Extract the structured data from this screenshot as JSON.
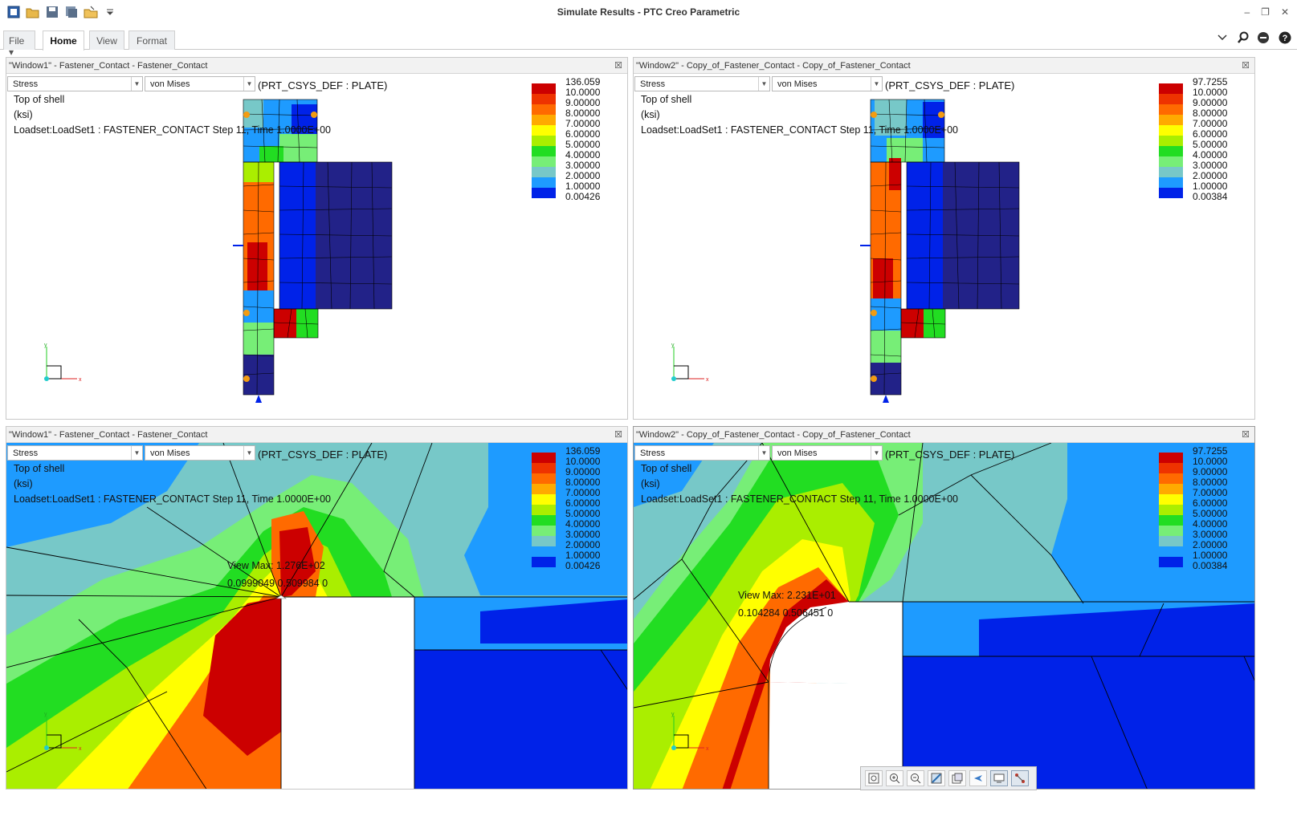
{
  "window": {
    "title": "Simulate Results - PTC Creo Parametric",
    "controls": [
      "minimize-icon",
      "restore-icon",
      "close-icon"
    ]
  },
  "quick_access": [
    "app-icon",
    "open-icon",
    "save-icon",
    "save-copy-icon",
    "open-folder-icon",
    "customize-dropdown-icon"
  ],
  "ribbon": {
    "tabs": [
      {
        "label": "File"
      },
      {
        "label": "Home",
        "active": true
      },
      {
        "label": "View"
      },
      {
        "label": "Format"
      }
    ],
    "right_icons": [
      "collapse-ribbon-icon",
      "search-icon",
      "community-icon",
      "help-icon"
    ]
  },
  "panes": [
    {
      "title": "\"Window1\" - Fastener_Contact - Fastener_Contact",
      "quantity": "Stress",
      "component": "von Mises",
      "csys": "(PRT_CSYS_DEF : PLATE)",
      "info": [
        "Top of shell",
        "(ksi)",
        "Loadset:LoadSet1 :  FASTENER_CONTACT Step 11, Time  1.0000E+00"
      ],
      "legend": [
        "136.059",
        "10.0000",
        "9.00000",
        "8.00000",
        "7.00000",
        "6.00000",
        "5.00000",
        "4.00000",
        "3.00000",
        "2.00000",
        "1.00000",
        "0.00426"
      ]
    },
    {
      "title": "\"Window2\" - Copy_of_Fastener_Contact - Copy_of_Fastener_Contact",
      "quantity": "Stress",
      "component": "von Mises",
      "csys": "(PRT_CSYS_DEF : PLATE)",
      "info": [
        "Top of shell",
        "(ksi)",
        "Loadset:LoadSet1 :  FASTENER_CONTACT Step 11, Time  1.0000E+00"
      ],
      "legend": [
        "97.7255",
        "10.0000",
        "9.00000",
        "8.00000",
        "7.00000",
        "6.00000",
        "5.00000",
        "4.00000",
        "3.00000",
        "2.00000",
        "1.00000",
        "0.00384"
      ]
    },
    {
      "title": "\"Window1\" - Fastener_Contact - Fastener_Contact",
      "quantity": "Stress",
      "component": "von Mises",
      "csys": "(PRT_CSYS_DEF : PLATE)",
      "info": [
        "Top of shell",
        "(ksi)",
        "Loadset:LoadSet1 :  FASTENER_CONTACT Step 11, Time  1.0000E+00"
      ],
      "legend": [
        "136.059",
        "10.0000",
        "9.00000",
        "8.00000",
        "7.00000",
        "6.00000",
        "5.00000",
        "4.00000",
        "3.00000",
        "2.00000",
        "1.00000",
        "0.00426"
      ],
      "view_max": [
        "View Max:  1.276E+02",
        "0.0999049  0.509984  0"
      ]
    },
    {
      "title": "\"Window2\" - Copy_of_Fastener_Contact - Copy_of_Fastener_Contact",
      "quantity": "Stress",
      "component": "von Mises",
      "csys": "(PRT_CSYS_DEF : PLATE)",
      "info": [
        "Top of shell",
        "(ksi)",
        "Loadset:LoadSet1 :  FASTENER_CONTACT Step 11, Time  1.0000E+00"
      ],
      "legend": [
        "97.7255",
        "10.0000",
        "9.00000",
        "8.00000",
        "7.00000",
        "6.00000",
        "5.00000",
        "4.00000",
        "3.00000",
        "2.00000",
        "1.00000",
        "0.00384"
      ],
      "view_max": [
        "View Max:  2.231E+01",
        "0.104284  0.506451  0"
      ]
    }
  ],
  "legend_colors": [
    "#cc0000",
    "#ee3300",
    "#ff6a00",
    "#ffaa00",
    "#ffff00",
    "#aaee00",
    "#22dd22",
    "#77ee77",
    "#77c8c8",
    "#1e9bff",
    "#0022e8",
    "#222288"
  ],
  "axis_labels": {
    "x": "x",
    "y": "y"
  },
  "zoom_toolbar": [
    "refit-icon",
    "zoom-in-icon",
    "zoom-out-icon",
    "repaint-icon",
    "saved-views-icon",
    "spin-center-icon",
    "model-display-icon",
    "datum-display-icon"
  ]
}
